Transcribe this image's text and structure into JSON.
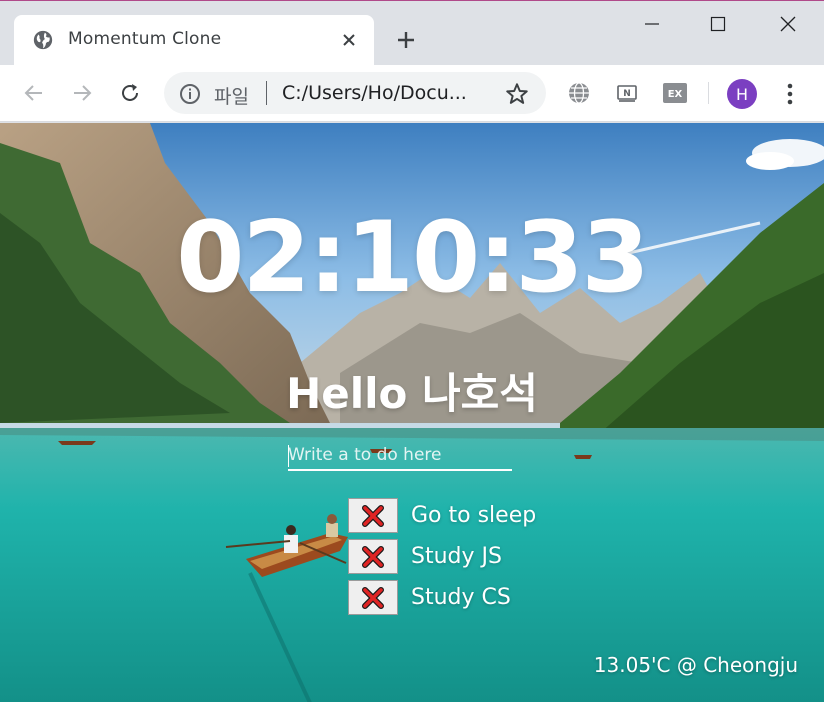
{
  "browser": {
    "tab": {
      "title": "Momentum Clone",
      "favicon": "globe-icon"
    },
    "window_controls": [
      "minimize-icon",
      "maximize-icon",
      "close-icon"
    ],
    "omnibox": {
      "scheme_label": "파일",
      "url": "C:/Users/Ho/Docu..."
    },
    "extensions": [
      "globe-extension-icon",
      "naver-extension-icon",
      "ex-extension-icon"
    ],
    "ex_label": "EX",
    "ext_n_label": "N",
    "avatar_initial": "H",
    "avatar_color": "#7b3fc1"
  },
  "page": {
    "clock": "02:10:33",
    "greeting": "Hello 나호석",
    "todo_form": {
      "placeholder": "Write a to do here",
      "value": ""
    },
    "todos": [
      {
        "text": "Go to sleep",
        "delete_icon": "red-x-icon"
      },
      {
        "text": "Study JS",
        "delete_icon": "red-x-icon"
      },
      {
        "text": "Study CS",
        "delete_icon": "red-x-icon"
      }
    ],
    "weather": "13.05'C @ Cheongju"
  }
}
